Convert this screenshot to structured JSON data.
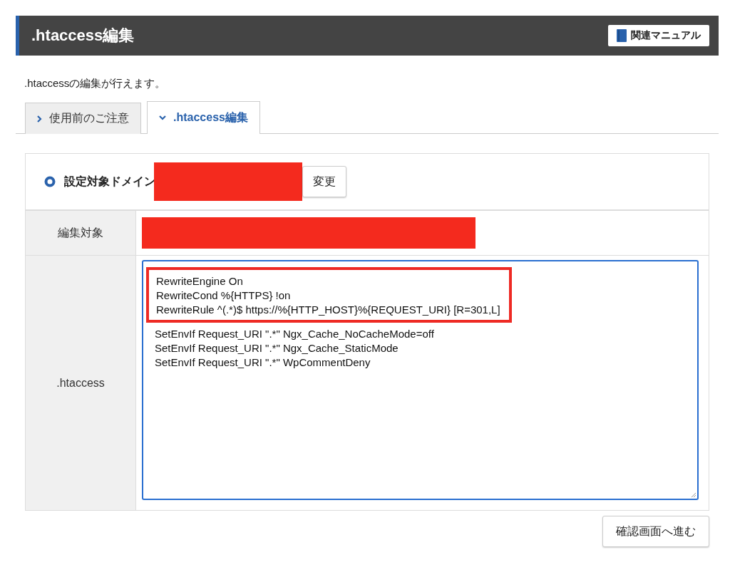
{
  "header": {
    "title": ".htaccess編集",
    "manual_button": "関連マニュアル"
  },
  "description": ".htaccessの編集が行えます。",
  "tabs": [
    {
      "label": "使用前のご注意",
      "selected": false
    },
    {
      "label": ".htaccess編集",
      "selected": true
    }
  ],
  "domain": {
    "label": "設定対象ドメイン",
    "change_button": "変更"
  },
  "rows": [
    {
      "kind": "redacted",
      "label": "編集対象"
    },
    {
      "kind": "editor",
      "label": ".htaccess",
      "highlighted_lines": [
        "RewriteEngine On",
        "RewriteCond %{HTTPS} !on",
        "RewriteRule ^(.*)$ https://%{HTTP_HOST}%{REQUEST_URI} [R=301,L]"
      ],
      "lines": [
        "SetEnvIf Request_URI \".*\" Ngx_Cache_NoCacheMode=off",
        "SetEnvIf Request_URI \".*\" Ngx_Cache_StaticMode",
        "SetEnvIf Request_URI \".*\" WpCommentDeny"
      ]
    }
  ],
  "confirm_button": "確認画面へ進む"
}
